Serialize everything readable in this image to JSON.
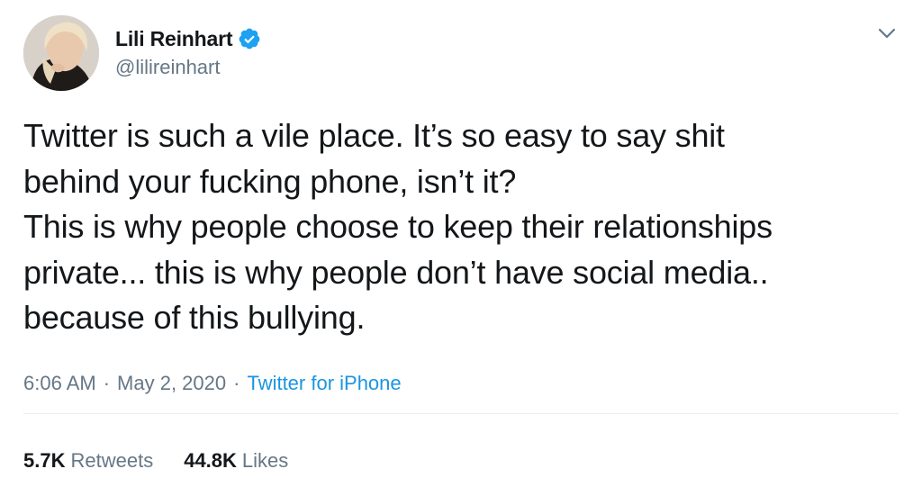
{
  "author": {
    "display_name": "Lili Reinhart",
    "handle": "@lilireinhart",
    "verified": true
  },
  "tweet": {
    "lines": [
      "Twitter is such a vile place. It’s so easy to say shit",
      "behind your fucking phone, isn’t it?",
      "This is why people choose to keep their relationships",
      "private... this is why people don’t have social media..",
      "because of this bullying."
    ],
    "time": "6:06 AM",
    "separator_1": "·",
    "date": "May 2, 2020",
    "separator_2": "·",
    "source": "Twitter for iPhone"
  },
  "stats": {
    "retweets_count": "5.7K",
    "retweets_label": "Retweets",
    "likes_count": "44.8K",
    "likes_label": "Likes"
  },
  "icons": {
    "verified": "verified-badge-icon",
    "menu": "chevron-down-icon"
  },
  "colors": {
    "text_primary": "#14171a",
    "text_secondary": "#657786",
    "link": "#1b95e0",
    "verified_badge": "#1da1f2",
    "divider": "#e6ecf0"
  }
}
